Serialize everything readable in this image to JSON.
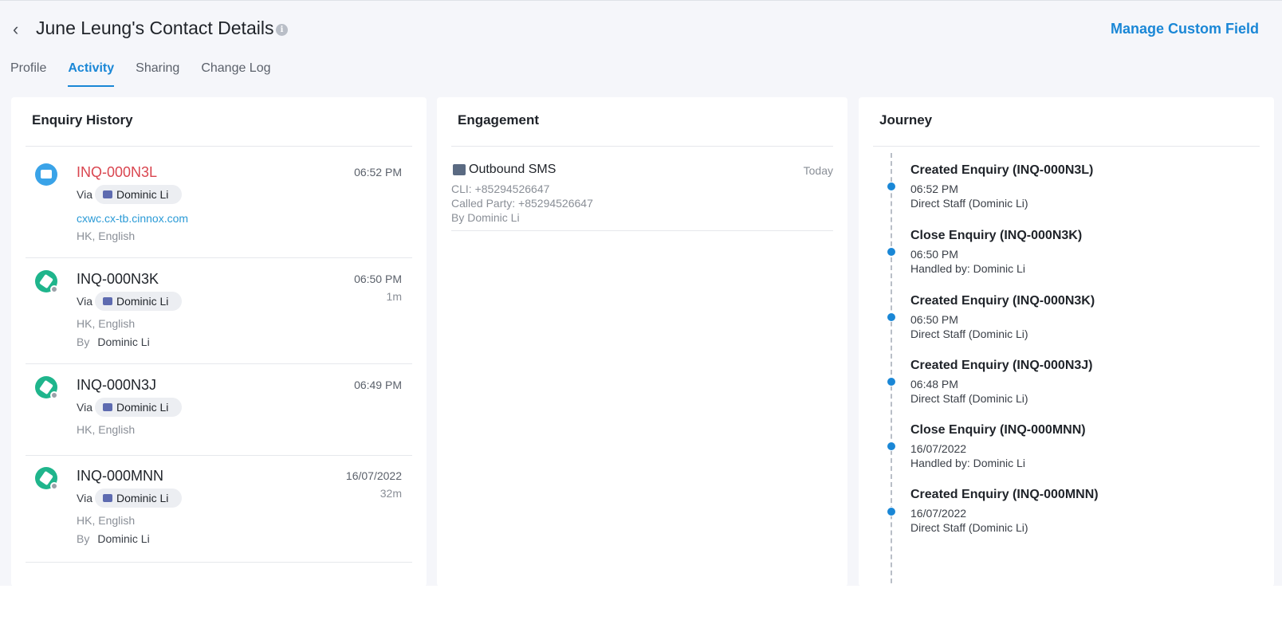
{
  "header": {
    "title": "June Leung's Contact Details",
    "manage_label": "Manage Custom Field"
  },
  "tabs": [
    {
      "label": "Profile",
      "active": false
    },
    {
      "label": "Activity",
      "active": true
    },
    {
      "label": "Sharing",
      "active": false
    },
    {
      "label": "Change Log",
      "active": false
    }
  ],
  "enquiry_history": {
    "title": "Enquiry History",
    "items": [
      {
        "id": "INQ-000N3L",
        "time": "06:52 PM",
        "via_label": "Via",
        "agent": "Dominic Li",
        "link": "cxwc.cx-tb.cinnox.com",
        "locale": "HK, English",
        "icon": "chat-icon"
      },
      {
        "id": "INQ-000N3K",
        "time": "06:50 PM",
        "duration": "1m",
        "via_label": "Via",
        "agent": "Dominic Li",
        "locale": "HK, English",
        "by_label": "By",
        "by": "Dominic Li",
        "icon": "ticket-icon"
      },
      {
        "id": "INQ-000N3J",
        "time": "06:49 PM",
        "via_label": "Via",
        "agent": "Dominic Li",
        "locale": "HK, English",
        "icon": "ticket-icon"
      },
      {
        "id": "INQ-000MNN",
        "time": "16/07/2022",
        "duration": "32m",
        "via_label": "Via",
        "agent": "Dominic Li",
        "locale": "HK, English",
        "by_label": "By",
        "by": "Dominic Li",
        "icon": "ticket-icon"
      }
    ]
  },
  "engagement": {
    "title": "Engagement",
    "items": [
      {
        "title": "Outbound SMS",
        "date": "Today",
        "cli": "CLI: +85294526647",
        "called_party": "Called Party: +85294526647",
        "by": "By Dominic Li",
        "icon": "sms-icon"
      }
    ]
  },
  "journey": {
    "title": "Journey",
    "items": [
      {
        "title": "Created Enquiry (INQ-000N3L)",
        "time": "06:52 PM",
        "detail": "Direct Staff (Dominic Li)"
      },
      {
        "title": "Close Enquiry (INQ-000N3K)",
        "time": "06:50 PM",
        "detail": "Handled by: Dominic Li"
      },
      {
        "title": "Created Enquiry (INQ-000N3K)",
        "time": "06:50 PM",
        "detail": "Direct Staff (Dominic Li)"
      },
      {
        "title": "Created Enquiry (INQ-000N3J)",
        "time": "06:48 PM",
        "detail": "Direct Staff (Dominic Li)"
      },
      {
        "title": "Close Enquiry (INQ-000MNN)",
        "time": "16/07/2022",
        "detail": "Handled by: Dominic Li"
      },
      {
        "title": "Created Enquiry (INQ-000MNN)",
        "time": "16/07/2022",
        "detail": "Direct Staff (Dominic Li)"
      }
    ]
  },
  "colors": {
    "accent": "#1a87d6",
    "enquiry_highlight": "#d9454f",
    "chat_icon": "#3aa3e8",
    "ticket_icon": "#1fb58c"
  }
}
